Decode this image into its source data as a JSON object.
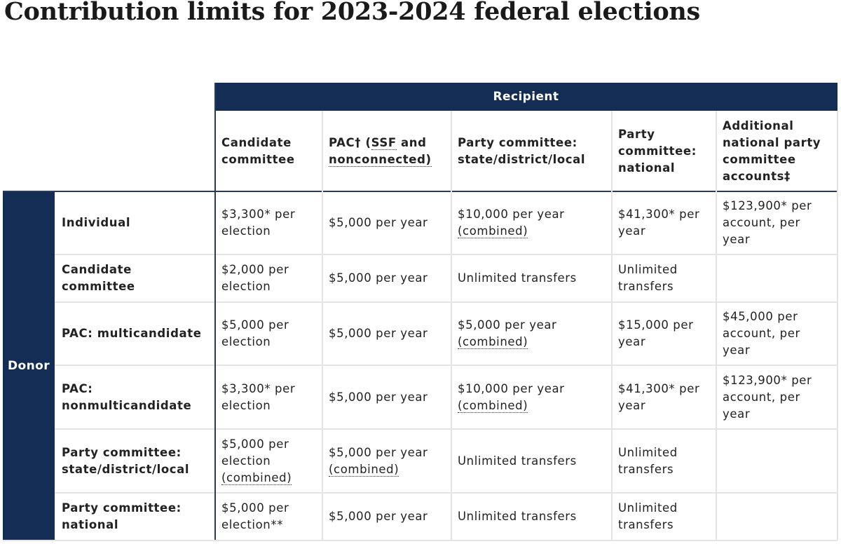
{
  "title": "Contribution limits for 2023-2024 federal elections",
  "table": {
    "recipient_label": "Recipient",
    "donor_label": "Donor",
    "columns": [
      {
        "label_parts": [
          "Candidate committee"
        ]
      },
      {
        "label_pre": "PAC† (",
        "label_abbr": "SSF",
        "label_mid": " and ",
        "label_abbr2": "nonconnected)",
        "label_full": "PAC† (SSF and nonconnected)"
      },
      {
        "label": "Party committee: state/district/local"
      },
      {
        "label": "Party committee: national"
      },
      {
        "label": "Additional national party committee accounts‡"
      }
    ],
    "column_labels": [
      "Candidate committee",
      "PAC† (SSF and nonconnected)",
      "Party committee: state/district/local",
      "Party committee: national",
      "Additional national party committee accounts‡"
    ],
    "rows": [
      {
        "donor": "Individual",
        "cells": [
          {
            "text": "$3,300* per election"
          },
          {
            "text": "$5,000 per year"
          },
          {
            "text": "$10,000 per year",
            "note": "(combined)"
          },
          {
            "text": "$41,300* per year"
          },
          {
            "text": "$123,900* per account, per year"
          }
        ]
      },
      {
        "donor": "Candidate committee",
        "cells": [
          {
            "text": "$2,000 per election"
          },
          {
            "text": "$5,000 per year"
          },
          {
            "text": "Unlimited transfers"
          },
          {
            "text": "Unlimited transfers"
          },
          {
            "text": ""
          }
        ]
      },
      {
        "donor": "PAC: multicandidate",
        "cells": [
          {
            "text": "$5,000 per election"
          },
          {
            "text": "$5,000 per year"
          },
          {
            "text": "$5,000 per year",
            "note": "(combined)"
          },
          {
            "text": "$15,000 per year"
          },
          {
            "text": "$45,000 per account, per year"
          }
        ]
      },
      {
        "donor": "PAC: nonmulticandidate",
        "cells": [
          {
            "text": "$3,300* per election"
          },
          {
            "text": "$5,000 per year"
          },
          {
            "text": "$10,000 per year",
            "note": "(combined)"
          },
          {
            "text": "$41,300* per year"
          },
          {
            "text": "$123,900* per account, per year"
          }
        ]
      },
      {
        "donor": "Party committee: state/district/local",
        "cells": [
          {
            "text": "$5,000 per election",
            "note": "(combined)"
          },
          {
            "text": "$5,000 per year",
            "note": "(combined)"
          },
          {
            "text": "Unlimited transfers"
          },
          {
            "text": "Unlimited transfers"
          },
          {
            "text": ""
          }
        ]
      },
      {
        "donor": "Party committee: national",
        "cells": [
          {
            "text": "$5,000 per election**"
          },
          {
            "text": "$5,000 per year"
          },
          {
            "text": "Unlimited transfers"
          },
          {
            "text": "Unlimited transfers"
          },
          {
            "text": ""
          }
        ]
      }
    ]
  },
  "colors": {
    "header_bg": "#132d54",
    "header_text": "#ffffff",
    "body_text": "#222222",
    "grid_line": "#e4e4e4",
    "dark_line": "#2b3b52"
  }
}
